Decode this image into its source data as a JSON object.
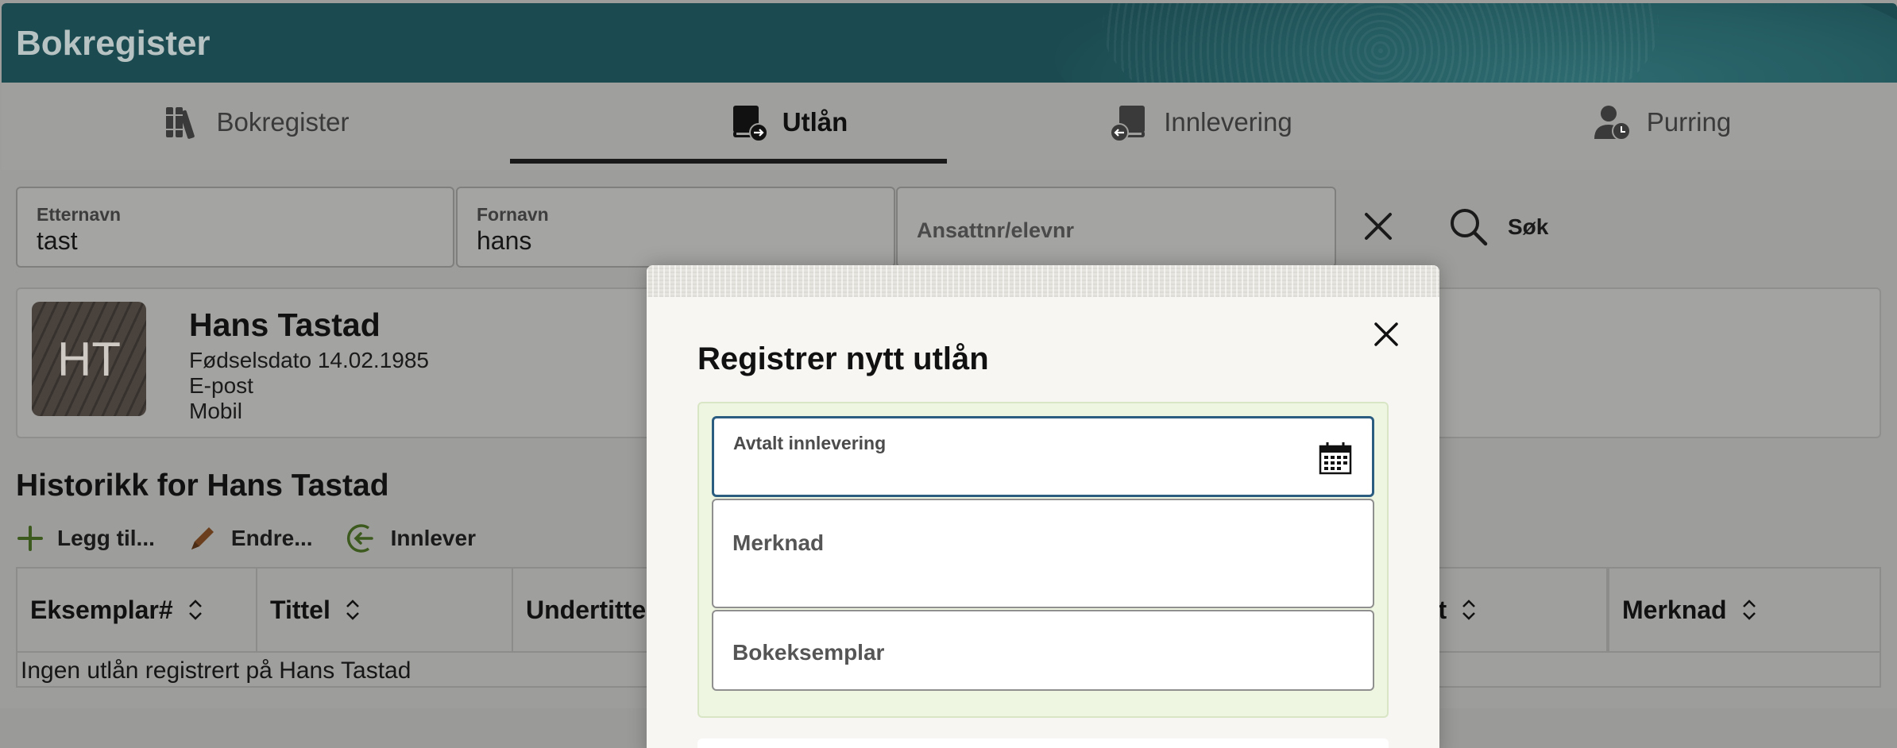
{
  "app": {
    "title": "Bokregister"
  },
  "nav": {
    "tabs": [
      {
        "label": "Bokregister",
        "icon": "books-icon"
      },
      {
        "label": "Utlån",
        "icon": "book-loan-icon",
        "active": true
      },
      {
        "label": "Innlevering",
        "icon": "book-return-icon"
      },
      {
        "label": "Purring",
        "icon": "user-clock-icon"
      }
    ]
  },
  "search": {
    "etternavn": {
      "label": "Etternavn",
      "value": "tast"
    },
    "fornavn": {
      "label": "Fornavn",
      "value": "hans"
    },
    "ansattnr": {
      "placeholder": "Ansattnr/elevnr"
    },
    "search_label": "Søk"
  },
  "person": {
    "initials": "HT",
    "name": "Hans Tastad",
    "birth": "Fødselsdato 14.02.1985",
    "email": "E-post",
    "mobile": "Mobil"
  },
  "history": {
    "title": "Historikk for Hans Tastad",
    "toolbar": {
      "add": "Legg til...",
      "edit": "Endre...",
      "return": "Innlever"
    },
    "columns": [
      "Eksemplar#",
      "Tittel",
      "Undertitte",
      "rt",
      "Merknad"
    ],
    "empty": "Ingen utlån registrert på Hans Tastad"
  },
  "modal": {
    "title": "Registrer nytt utlån",
    "fields": {
      "due": "Avtalt innlevering",
      "note": "Merknad",
      "copy": "Bokeksemplar"
    }
  },
  "colors": {
    "header": "#1b4a50",
    "focus": "#2b5d80",
    "form_bg": "#eef5e1",
    "add_icon": "#3d5a1e",
    "edit_icon": "#6b3f1e"
  }
}
